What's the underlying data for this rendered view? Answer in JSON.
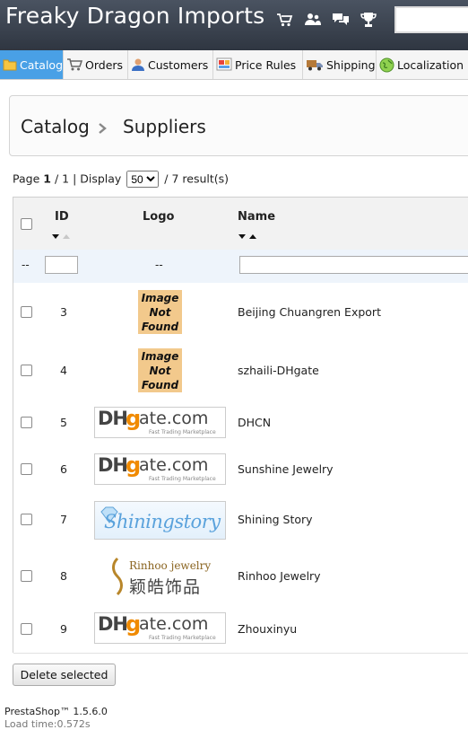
{
  "header": {
    "shop_name": "Freaky Dragon Imports",
    "icons": [
      "cart-icon",
      "customers-icon",
      "messages-icon",
      "trophy-icon"
    ],
    "search": {
      "value": "",
      "placeholder": ""
    }
  },
  "tabs": [
    {
      "label": "Catalog",
      "icon": "folder-icon",
      "active": true
    },
    {
      "label": "Orders",
      "icon": "cart-icon",
      "active": false
    },
    {
      "label": "Customers",
      "icon": "user-icon",
      "active": false
    },
    {
      "label": "Price Rules",
      "icon": "price-tag-icon",
      "active": false
    },
    {
      "label": "Shipping",
      "icon": "truck-icon",
      "active": false
    },
    {
      "label": "Localization",
      "icon": "globe-icon",
      "active": false
    }
  ],
  "breadcrumb": {
    "first": "Catalog",
    "second": "Suppliers"
  },
  "pagination": {
    "page_prefix": "Page",
    "current_page": "1",
    "total_pages": "/ 1",
    "display_label": "| Display",
    "display_value": "50",
    "results": "/ 7 result(s)"
  },
  "table": {
    "headers": {
      "id": "ID",
      "logo": "Logo",
      "name": "Name"
    },
    "filters": {
      "select_placeholder": "--",
      "logo_placeholder": "--",
      "id_value": "",
      "name_value": ""
    },
    "rows": [
      {
        "id": "3",
        "logo": "Image Not Found",
        "name": "Beijing Chuangren Export"
      },
      {
        "id": "4",
        "logo": "Image Not Found",
        "name": "szhaili-DHgate"
      },
      {
        "id": "5",
        "logo": "DHgate.com",
        "name": "DHCN"
      },
      {
        "id": "6",
        "logo": "DHgate.com",
        "name": "Sunshine Jewelry"
      },
      {
        "id": "7",
        "logo": "Shiningstory",
        "name": "Shining Story"
      },
      {
        "id": "8",
        "logo": "Rinhoo jewelry",
        "name": "Rinhoo Jewelry"
      },
      {
        "id": "9",
        "logo": "DHgate.com",
        "name": "Zhouxinyu"
      }
    ],
    "logos": {
      "not_found_lines": [
        "Image",
        "Not",
        "Found"
      ],
      "dhgate_left": "DH",
      "dhgate_right": "ate.com",
      "dhgate_tagline": "Fast Trading Marketplace",
      "shining": "Shiningstory",
      "rinhoo_en": "Rinhoo jewelry",
      "rinhoo_cn": "颖皓饰品"
    }
  },
  "actions": {
    "delete_selected": "Delete selected"
  },
  "footer": {
    "version": "PrestaShop™ 1.5.6.0",
    "load_time": "Load time:0.572s"
  },
  "colors": {
    "topbar": "#3a4250",
    "active_tab": "#49a0e6",
    "filter_row": "#eef4fb",
    "image_not_found": "#f2c98c",
    "dhgate_orange": "#f08a00"
  }
}
